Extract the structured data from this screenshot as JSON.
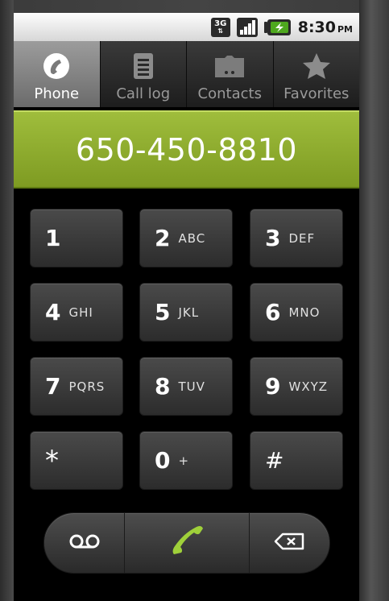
{
  "status_bar": {
    "network_type": "3G",
    "time": "8:30",
    "ampm": "PM"
  },
  "tabs": [
    {
      "label": "Phone",
      "icon": "phone-icon",
      "active": true
    },
    {
      "label": "Call log",
      "icon": "call-log-icon",
      "active": false
    },
    {
      "label": "Contacts",
      "icon": "contacts-icon",
      "active": false
    },
    {
      "label": "Favorites",
      "icon": "star-icon",
      "active": false
    }
  ],
  "display": {
    "number": "650-450-8810"
  },
  "keypad": {
    "keys": [
      {
        "digit": "1",
        "letters": ""
      },
      {
        "digit": "2",
        "letters": "ABC"
      },
      {
        "digit": "3",
        "letters": "DEF"
      },
      {
        "digit": "4",
        "letters": "GHI"
      },
      {
        "digit": "5",
        "letters": "JKL"
      },
      {
        "digit": "6",
        "letters": "MNO"
      },
      {
        "digit": "7",
        "letters": "PQRS"
      },
      {
        "digit": "8",
        "letters": "TUV"
      },
      {
        "digit": "9",
        "letters": "WXYZ"
      },
      {
        "digit": "*",
        "letters": ""
      },
      {
        "digit": "0",
        "letters": "+"
      },
      {
        "digit": "#",
        "letters": ""
      }
    ]
  },
  "actions": {
    "voicemail_icon": "voicemail-icon",
    "call_icon": "call-icon",
    "delete_icon": "backspace-icon"
  },
  "colors": {
    "accent_green": "#8fae2e",
    "call_green": "#a3d43c",
    "active_tab": "#8a8a8a"
  }
}
